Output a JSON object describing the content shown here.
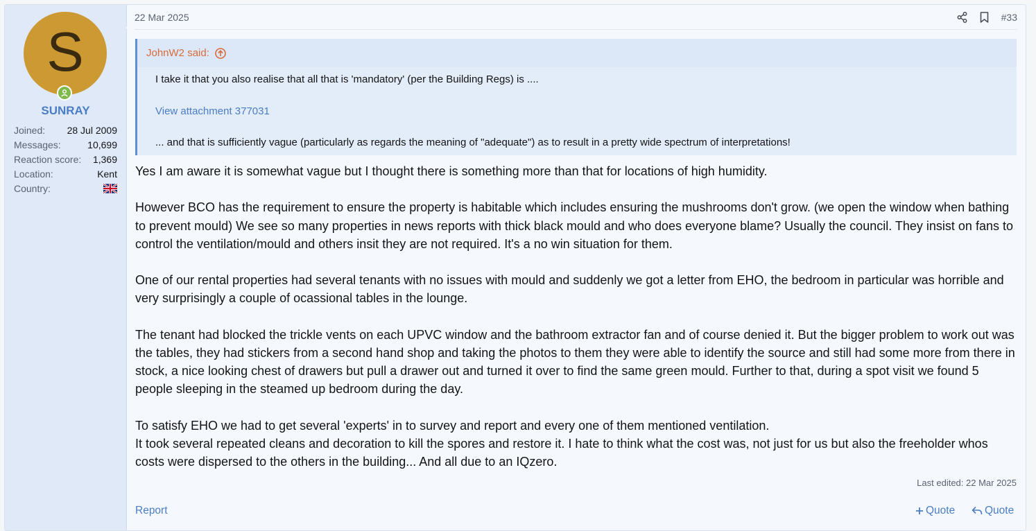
{
  "user": {
    "avatar_letter": "S",
    "avatar_color": "#cc9933",
    "username": "SUNRAY",
    "stats": [
      {
        "label": "Joined:",
        "value": "28 Jul 2009"
      },
      {
        "label": "Messages:",
        "value": "10,699"
      },
      {
        "label": "Reaction score:",
        "value": "1,369"
      },
      {
        "label": "Location:",
        "value": "Kent"
      },
      {
        "label": "Country:",
        "value": ""
      }
    ],
    "country_flag_icon": "uk-flag-icon"
  },
  "post": {
    "date": "22 Mar 2025",
    "number": "#33",
    "quote": {
      "author": "JohnW2 said:",
      "line1": "I take it that you also realise that all that is 'mandatory' (per the Building Regs) is ....",
      "attachment": "View attachment 377031",
      "line2": "... and that is sufficiently vague (particularly as regards the meaning of \"adequate\") as to result in a pretty wide spectrum of interpretations!"
    },
    "paragraphs": [
      "Yes I am aware it is somewhat vague but I thought there is something more than that for locations of high humidity.",
      "However BCO has the requirement to ensure the property is habitable which includes ensuring the mushrooms don't grow. (we open the window when bathing to prevent mould) We see so many properties in news reports with thick black mould and who does everyone blame? Usually the council. They insist on fans to control the ventilation/mould and others insit they are not required. It's a no win situation for them.",
      "One of our rental properties had several tenants with no issues with mould and suddenly we got a letter from EHO, the bedroom in particular was horrible and very surprisingly a couple of ocassional tables in the lounge.",
      "The tenant had blocked the trickle vents on each UPVC window and the bathroom extractor fan and of course denied it. But the bigger problem to work out was the tables, they had stickers from a second hand shop and taking the photos to them they were able to identify the source and still had some more from there in stock, a nice looking chest of drawers but pull a drawer out and turned it over to find the same green mould. Further to that, during a spot visit we found 5 people sleeping in the steamed up bedroom during the day.",
      "To satisfy EHO we had to get several 'experts' in to survey and report and every one of them mentioned ventilation.\nIt took several repeated cleans and decoration to kill the spores and restore it. I hate to think what the cost was, not just for us but also the freeholder whos costs were dispersed to the others in the building... And all due to an IQzero."
    ],
    "last_edited": "Last edited: 22 Mar 2025",
    "report_label": "Report",
    "multiquote_label": "Quote",
    "quote_label": "Quote"
  },
  "colors": {
    "accent": "#4a7dc4",
    "quote_author": "#d96b3b",
    "online": "#7fb94a"
  }
}
